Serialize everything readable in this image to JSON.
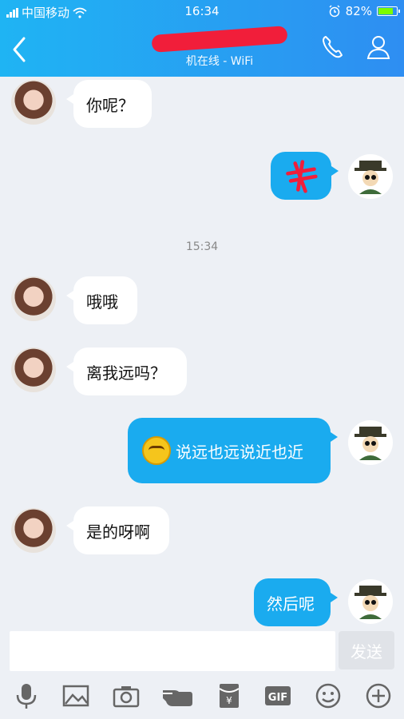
{
  "status_bar": {
    "carrier": "中国移动",
    "time": "16:34",
    "battery_percent": "82%",
    "battery_level": 0.82,
    "battery_color": "#7CFC00"
  },
  "header": {
    "subtitle": "机在线 - WiFi",
    "back_icon": "back-chevron-icon",
    "call_icon": "phone-icon",
    "profile_icon": "person-icon"
  },
  "messages": [
    {
      "side": "in",
      "text": "你呢？"
    },
    {
      "side": "out",
      "text": "",
      "redacted": true
    },
    {
      "side": "in",
      "text": "哦哦"
    },
    {
      "side": "in",
      "text": "离我远吗？"
    },
    {
      "side": "out",
      "text": "说远也远说近也近",
      "emoji": "sly-smile-emoji"
    },
    {
      "side": "in",
      "text": "是的呀啊"
    },
    {
      "side": "out",
      "text": "然后呢"
    }
  ],
  "timestamp": "15:34",
  "input": {
    "placeholder": "",
    "send_label": "发送"
  },
  "toolbar": {
    "items": [
      "microphone-icon",
      "image-icon",
      "camera-icon",
      "hand-gesture-icon",
      "red-packet-icon",
      "gif-icon",
      "emoji-icon",
      "plus-icon"
    ],
    "gif_label": "GIF",
    "yen_label": "¥"
  },
  "colors": {
    "header_gradient_start": "#1FB4F3",
    "header_gradient_end": "#2E8EF2",
    "outgoing_bubble": "#1AABEF",
    "incoming_bubble": "#FFFFFF",
    "background": "#EDF0F5",
    "redaction": "#F11E3A"
  }
}
